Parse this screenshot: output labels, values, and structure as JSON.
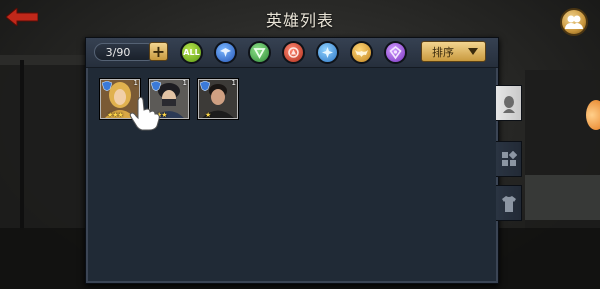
{
  "header": {
    "title": "英雄列表",
    "back_icon": "back-arrow-icon",
    "group_icon": "group-icon"
  },
  "inventory": {
    "count": "3/90",
    "add_label": "+"
  },
  "filters": [
    {
      "id": "all",
      "label": "ALL",
      "color": "#7fc52a"
    },
    {
      "id": "blue",
      "icon": "wings-emblem-icon",
      "color": "#3d7bdc"
    },
    {
      "id": "green",
      "icon": "down-arrow-emblem-icon",
      "color": "#3aa048"
    },
    {
      "id": "red",
      "icon": "triangle-emblem-icon",
      "color": "#d0432c"
    },
    {
      "id": "cyan",
      "icon": "star-cross-emblem-icon",
      "color": "#3f95e0"
    },
    {
      "id": "gold",
      "icon": "eagle-emblem-icon",
      "color": "#e0a530"
    },
    {
      "id": "purple",
      "icon": "gem-emblem-icon",
      "color": "#9a4fd8"
    }
  ],
  "sort": {
    "label": "排序"
  },
  "heroes": [
    {
      "name": "blonde-hero",
      "level": "1",
      "stars": "★★★"
    },
    {
      "name": "masked-hero",
      "level": "1",
      "stars": "★★"
    },
    {
      "name": "dark-hair-hero",
      "level": "1",
      "stars": "★"
    }
  ],
  "tabs": [
    {
      "id": "hero",
      "icon": "head-silhouette-icon",
      "active": true
    },
    {
      "id": "fragments",
      "icon": "squares-icon",
      "active": false
    },
    {
      "id": "equipment",
      "icon": "shirt-icon",
      "active": false
    }
  ]
}
